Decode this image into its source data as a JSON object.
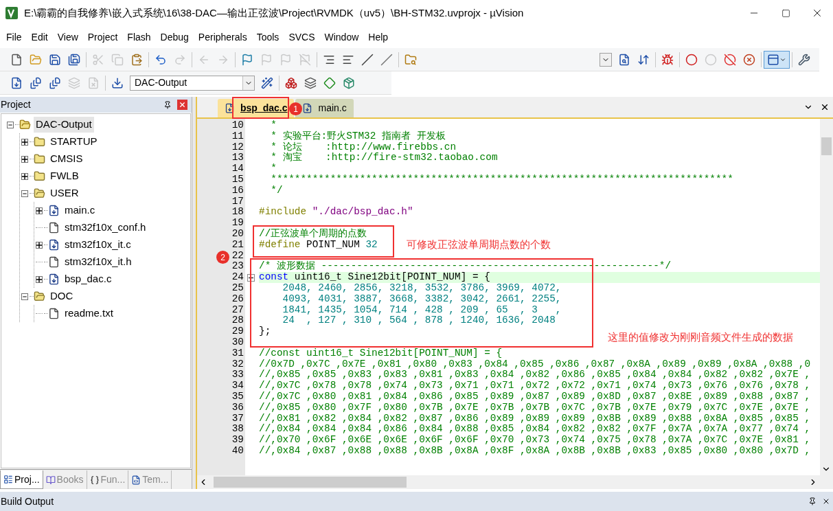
{
  "window": {
    "title": "E:\\霸霸的自我修养\\嵌入式系统\\16\\38-DAC—输出正弦波\\Project\\RVMDK（uv5）\\BH-STM32.uvprojx - µVision"
  },
  "menu": [
    "File",
    "Edit",
    "View",
    "Project",
    "Flash",
    "Debug",
    "Peripherals",
    "Tools",
    "SVCS",
    "Window",
    "Help"
  ],
  "toolbars": [
    {
      "items": [
        {
          "kind": "new",
          "disabled": false
        },
        {
          "kind": "open",
          "disabled": false
        },
        {
          "kind": "save",
          "disabled": false
        },
        {
          "kind": "save_all",
          "disabled": false
        },
        {
          "kind": "separator"
        },
        {
          "kind": "cut",
          "disabled": true
        },
        {
          "kind": "copy",
          "disabled": true
        },
        {
          "kind": "paste",
          "disabled": false
        },
        {
          "kind": "separator"
        },
        {
          "kind": "undo",
          "disabled": false
        },
        {
          "kind": "redo",
          "disabled": true
        },
        {
          "kind": "separator"
        },
        {
          "kind": "back",
          "disabled": true
        },
        {
          "kind": "forward",
          "disabled": true
        },
        {
          "kind": "separator"
        },
        {
          "kind": "bookmark",
          "disabled": false
        },
        {
          "kind": "prev_bookmark",
          "disabled": true
        },
        {
          "kind": "next_bookmark",
          "disabled": true
        },
        {
          "kind": "clear_bookmarks",
          "disabled": true
        },
        {
          "kind": "separator"
        },
        {
          "kind": "indent",
          "disabled": false
        },
        {
          "kind": "unindent",
          "disabled": false
        },
        {
          "kind": "comment",
          "disabled": false
        },
        {
          "kind": "uncomment",
          "disabled": false
        },
        {
          "kind": "separator"
        },
        {
          "kind": "find_in_files",
          "disabled": false
        },
        {
          "kind": "spacer"
        },
        {
          "kind": "combo"
        },
        {
          "kind": "find",
          "disabled": false
        },
        {
          "kind": "browse",
          "disabled": false
        },
        {
          "kind": "separator"
        },
        {
          "kind": "debug",
          "disabled": false
        },
        {
          "kind": "separator"
        },
        {
          "kind": "breakpoint",
          "disabled": false
        },
        {
          "kind": "enable_breakpoint",
          "disabled": true
        },
        {
          "kind": "disable_breakpoints",
          "disabled": false
        },
        {
          "kind": "kill_breakpoints",
          "disabled": false
        },
        {
          "kind": "separator"
        },
        {
          "kind": "windows",
          "disabled": false,
          "pressed": true
        },
        {
          "kind": "separator"
        },
        {
          "kind": "configure",
          "disabled": false
        }
      ]
    },
    {
      "items": [
        {
          "kind": "translate",
          "disabled": false
        },
        {
          "kind": "build",
          "disabled": false
        },
        {
          "kind": "rebuild",
          "disabled": false
        },
        {
          "kind": "batch_build",
          "disabled": true
        },
        {
          "kind": "stop_build",
          "disabled": true
        },
        {
          "kind": "separator"
        },
        {
          "kind": "download",
          "disabled": false
        },
        {
          "kind": "combo",
          "value": "DAC-Output"
        },
        {
          "kind": "options",
          "disabled": false
        },
        {
          "kind": "separator"
        },
        {
          "kind": "manage_rte",
          "disabled": false
        },
        {
          "kind": "select_packs",
          "disabled": false
        },
        {
          "kind": "pack_installer",
          "disabled": false
        },
        {
          "kind": "event_recorder",
          "disabled": false
        }
      ]
    }
  ],
  "project_panel": {
    "title": "Project",
    "tree": [
      {
        "label": "DAC-Output",
        "kind": "target",
        "selected": true,
        "expanded": true,
        "children": [
          {
            "label": "STARTUP",
            "kind": "group",
            "selected": false,
            "expanded": false
          },
          {
            "label": "CMSIS",
            "kind": "group",
            "selected": false,
            "expanded": false
          },
          {
            "label": "FWLB",
            "kind": "group",
            "selected": false,
            "expanded": false
          },
          {
            "label": "USER",
            "kind": "group",
            "selected": false,
            "expanded": true,
            "children": [
              {
                "label": "main.c",
                "kind": "source",
                "selected": false,
                "expanded": false
              },
              {
                "label": "stm32f10x_conf.h",
                "kind": "header",
                "selected": false
              },
              {
                "label": "stm32f10x_it.c",
                "kind": "source",
                "selected": false,
                "expanded": false
              },
              {
                "label": "stm32f10x_it.h",
                "kind": "header",
                "selected": false
              },
              {
                "label": "bsp_dac.c",
                "kind": "source",
                "selected": false,
                "expanded": false
              }
            ]
          },
          {
            "label": "DOC",
            "kind": "group",
            "selected": false,
            "expanded": true,
            "children": [
              {
                "label": "readme.txt",
                "kind": "header",
                "selected": false
              }
            ]
          }
        ]
      }
    ],
    "tabs": [
      {
        "label": "Proj...",
        "kind": "project",
        "selected": true
      },
      {
        "label": "Books",
        "kind": "books",
        "selected": false
      },
      {
        "label": "Fun...",
        "kind": "functions",
        "selected": false
      },
      {
        "label": "Tem...",
        "kind": "templates",
        "selected": false
      }
    ]
  },
  "editor": {
    "tabs": [
      {
        "label": "bsp_dac.c",
        "selected": true
      },
      {
        "label": "main.c",
        "selected": false
      }
    ],
    "lines": [
      {
        "number": "10",
        "segments": [
          {
            "kind": "comment",
            "text": "  *"
          }
        ]
      },
      {
        "number": "11",
        "segments": [
          {
            "kind": "comment",
            "text": "  * 实验平台:野火STM32 指南者 开发板"
          }
        ]
      },
      {
        "number": "12",
        "segments": [
          {
            "kind": "comment",
            "text": "  * 论坛    :http://www.firebbs.cn"
          }
        ]
      },
      {
        "number": "13",
        "segments": [
          {
            "kind": "comment",
            "text": "  * 淘宝    :http://fire-stm32.taobao.com"
          }
        ]
      },
      {
        "number": "14",
        "segments": [
          {
            "kind": "comment",
            "text": "  *"
          }
        ]
      },
      {
        "number": "15",
        "segments": [
          {
            "kind": "comment",
            "text": "  ******************************************************************************"
          }
        ]
      },
      {
        "number": "16",
        "segments": [
          {
            "kind": "comment",
            "text": "  */"
          }
        ]
      },
      {
        "number": "17"
      },
      {
        "number": "18",
        "segments": [
          {
            "kind": "preprocessor",
            "text": "#include"
          },
          {
            "kind": "string",
            "text": " \"./dac/bsp_dac.h\""
          }
        ]
      },
      {
        "number": "19"
      },
      {
        "number": "20",
        "segments": [
          {
            "kind": "comment",
            "text": "//正弦波单个周期的点数"
          }
        ]
      },
      {
        "number": "21",
        "segments": [
          {
            "kind": "preprocessor",
            "text": "#define"
          },
          {
            "kind": "plain",
            "text": " POINT_NUM "
          },
          {
            "kind": "number",
            "text": "32"
          }
        ]
      },
      {
        "number": "22"
      },
      {
        "number": "23",
        "segments": [
          {
            "kind": "comment",
            "text": "/* 波形数据 ---------------------------------------------------------*/"
          }
        ]
      },
      {
        "number": "24",
        "collapsed": false,
        "current": true,
        "segments": [
          {
            "kind": "keyword",
            "text": "const"
          },
          {
            "kind": "plain",
            "text": " uint16_t Sine12bit[POINT_NUM] = {"
          }
        ]
      },
      {
        "number": "25",
        "segments": [
          {
            "kind": "number",
            "text": "    2048, 2460, 2856, 3218, 3532, 3786, 3969, 4072,"
          }
        ]
      },
      {
        "number": "26",
        "segments": [
          {
            "kind": "number",
            "text": "    4093, 4031, 3887, 3668, 3382, 3042, 2661, 2255,"
          }
        ]
      },
      {
        "number": "27",
        "segments": [
          {
            "kind": "number",
            "text": "    1841, 1435, 1054, 714 , 428 , 209 , 65  , 3   ,"
          }
        ]
      },
      {
        "number": "28",
        "segments": [
          {
            "kind": "number",
            "text": "    24  , 127 , 310 , 564 , 878 , 1240, 1636, 2048"
          }
        ]
      },
      {
        "number": "29",
        "segments": [
          {
            "kind": "plain",
            "text": "};"
          }
        ]
      },
      {
        "number": "30"
      },
      {
        "number": "31",
        "segments": [
          {
            "kind": "comment",
            "text": "//const uint16_t Sine12bit[POINT_NUM] = {"
          }
        ]
      },
      {
        "number": "32",
        "segments": [
          {
            "kind": "comment",
            "text": "//0x7D ,0x7C ,0x7E ,0x81 ,0x80 ,0x83 ,0x84 ,0x85 ,0x86 ,0x87 ,0x8A ,0x89 ,0x89 ,0x8A ,0x88 ,0"
          }
        ]
      },
      {
        "number": "33",
        "segments": [
          {
            "kind": "comment",
            "text": "//,0x85 ,0x85 ,0x83 ,0x83 ,0x81 ,0x83 ,0x84 ,0x82 ,0x86 ,0x85 ,0x84 ,0x84 ,0x82 ,0x82 ,0x7E ,"
          }
        ]
      },
      {
        "number": "34",
        "segments": [
          {
            "kind": "comment",
            "text": "//,0x7C ,0x78 ,0x78 ,0x74 ,0x73 ,0x71 ,0x71 ,0x72 ,0x72 ,0x71 ,0x74 ,0x73 ,0x76 ,0x76 ,0x78 ,"
          }
        ]
      },
      {
        "number": "35",
        "segments": [
          {
            "kind": "comment",
            "text": "//,0x7C ,0x80 ,0x81 ,0x84 ,0x86 ,0x85 ,0x89 ,0x87 ,0x89 ,0x8D ,0x87 ,0x8E ,0x89 ,0x88 ,0x87 ,"
          }
        ]
      },
      {
        "number": "36",
        "segments": [
          {
            "kind": "comment",
            "text": "//,0x85 ,0x80 ,0x7F ,0x80 ,0x7B ,0x7E ,0x7B ,0x7B ,0x7C ,0x7B ,0x7E ,0x79 ,0x7C ,0x7E ,0x7E ,"
          }
        ]
      },
      {
        "number": "37",
        "segments": [
          {
            "kind": "comment",
            "text": "//,0x81 ,0x82 ,0x84 ,0x82 ,0x87 ,0x86 ,0x89 ,0x89 ,0x89 ,0x8B ,0x89 ,0x88 ,0x8A ,0x85 ,0x85 ,"
          }
        ]
      },
      {
        "number": "38",
        "segments": [
          {
            "kind": "comment",
            "text": "//,0x84 ,0x84 ,0x84 ,0x86 ,0x84 ,0x88 ,0x85 ,0x84 ,0x82 ,0x82 ,0x7F ,0x7A ,0x7A ,0x77 ,0x74 ,"
          }
        ]
      },
      {
        "number": "39",
        "segments": [
          {
            "kind": "comment",
            "text": "//,0x70 ,0x6F ,0x6E ,0x6E ,0x6F ,0x6F ,0x70 ,0x73 ,0x74 ,0x75 ,0x78 ,0x7A ,0x7C ,0x7E ,0x81 ,"
          }
        ]
      },
      {
        "number": "40",
        "segments": [
          {
            "kind": "comment",
            "text": "//,0x84 ,0x87 ,0x88 ,0x88 ,0x8B ,0x8A ,0x8F ,0x8A ,0x8B ,0x8B ,0x83 ,0x85 ,0x80 ,0x80 ,0x7D ,"
          }
        ]
      }
    ]
  },
  "annotations": {
    "markers": [
      {
        "text": "1"
      },
      {
        "text": "2"
      }
    ],
    "notes": [
      {
        "text": "可修改正弦波单周期点数的个数"
      },
      {
        "text": "这里的值修改为刚刚音频文件生成的数据"
      }
    ]
  },
  "build_output": {
    "title": "Build Output"
  }
}
